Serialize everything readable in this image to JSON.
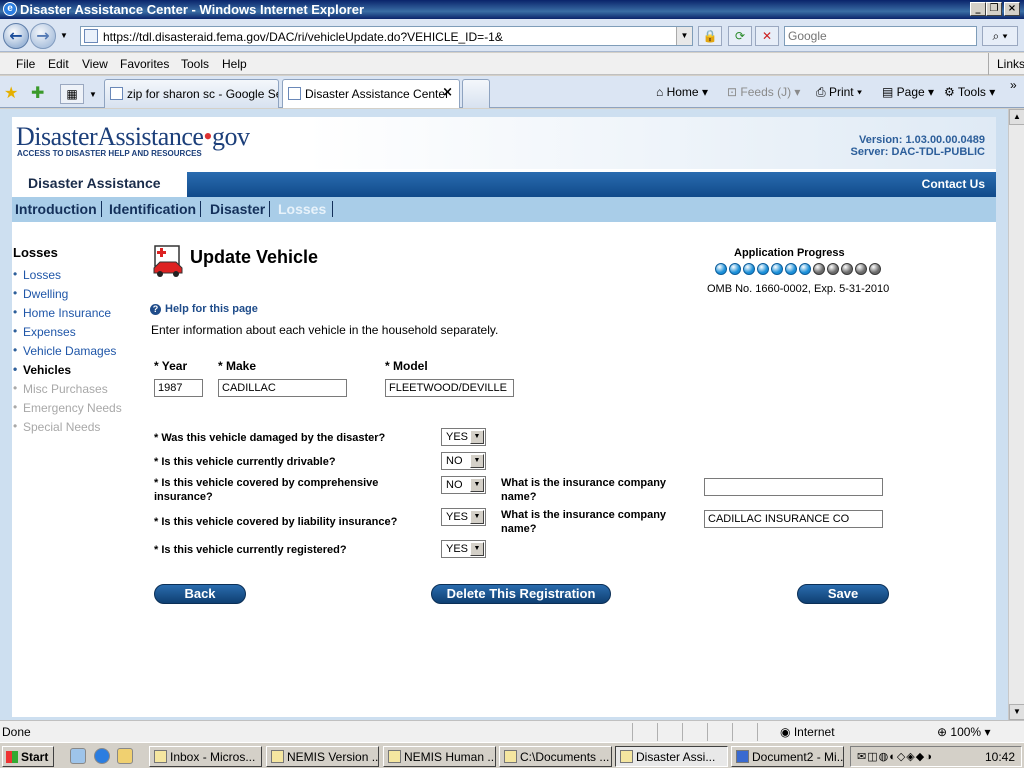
{
  "browser": {
    "window_title": "Disaster Assistance Center - Windows Internet Explorer",
    "url": "https://tdl.disasteraid.fema.gov/DAC/ri/vehicleUpdate.do?VEHICLE_ID=-1&",
    "search_placeholder": "Google",
    "menu": [
      "File",
      "Edit",
      "View",
      "Favorites",
      "Tools",
      "Help"
    ],
    "links_label": "Links",
    "tabs": [
      {
        "label": "zip for sharon sc - Google Se..."
      },
      {
        "label": "Disaster Assistance Center"
      }
    ],
    "commands": {
      "home": "Home",
      "feeds": "Feeds (J)",
      "print": "Print",
      "page": "Page",
      "tools": "Tools"
    },
    "status": {
      "text": "Done",
      "zone": "Internet",
      "zoom": "100%"
    }
  },
  "site": {
    "logo_main": "DisasterAssistance",
    "logo_dot": "•",
    "logo_gov": "gov",
    "logo_tagline": "ACCESS TO DISASTER HELP AND RESOURCES",
    "version": "Version: 1.03.00.00.0489",
    "server": "Server: DAC-TDL-PUBLIC",
    "section_tab": "Disaster Assistance",
    "contact": "Contact Us",
    "nav": [
      {
        "label": "Introduction",
        "active": false
      },
      {
        "label": "Identification",
        "active": false
      },
      {
        "label": "Disaster",
        "active": false
      },
      {
        "label": "Losses",
        "active": true
      }
    ]
  },
  "sidebar": {
    "heading": "Losses",
    "items": [
      {
        "label": "Losses",
        "state": "link"
      },
      {
        "label": "Dwelling",
        "state": "link"
      },
      {
        "label": "Home Insurance",
        "state": "link"
      },
      {
        "label": "Expenses",
        "state": "link"
      },
      {
        "label": "Vehicle Damages",
        "state": "link"
      },
      {
        "label": "Vehicles",
        "state": "current"
      },
      {
        "label": "Misc Purchases",
        "state": "disabled"
      },
      {
        "label": "Emergency Needs",
        "state": "disabled"
      },
      {
        "label": "Special Needs",
        "state": "disabled"
      }
    ]
  },
  "main": {
    "title": "Update Vehicle",
    "progress_title": "Application Progress",
    "progress": {
      "completed": 7,
      "total": 12,
      "done_color": "#1a8fd8",
      "todo_color": "#6a6a6a"
    },
    "omb": "OMB No. 1660-0002, Exp. 5-31-2010",
    "help_link": "Help for this page",
    "intro": "Enter information about each vehicle in the household separately.",
    "fields": {
      "year_label": "* Year",
      "year_value": "1987",
      "make_label": "* Make",
      "make_value": "CADILLAC",
      "model_label": "* Model",
      "model_value": "FLEETWOOD/DEVILLE"
    },
    "questions": {
      "damaged": {
        "label": "* Was this vehicle damaged by the disaster?",
        "value": "YES"
      },
      "drivable": {
        "label": "* Is this vehicle currently drivable?",
        "value": "NO"
      },
      "comprehensive": {
        "label": "* Is this vehicle covered by comprehensive insurance?",
        "value": "NO"
      },
      "liability": {
        "label": "* Is this vehicle covered by liability insurance?",
        "value": "YES"
      },
      "registered": {
        "label": "* Is this vehicle currently registered?",
        "value": "YES"
      }
    },
    "insurance_label": "What is the insurance company name?",
    "comprehensive_company": "",
    "liability_company": "CADILLAC INSURANCE CO",
    "buttons": {
      "back": "Back",
      "delete": "Delete This Registration",
      "save": "Save"
    }
  },
  "taskbar": {
    "start": "Start",
    "items": [
      {
        "label": "Inbox - Micros..."
      },
      {
        "label": "NEMIS Version ..."
      },
      {
        "label": "NEMIS Human ..."
      },
      {
        "label": "C:\\Documents ..."
      },
      {
        "label": "Disaster Assi..."
      },
      {
        "label": "Document2 - Mi..."
      }
    ],
    "clock": "10:42"
  }
}
